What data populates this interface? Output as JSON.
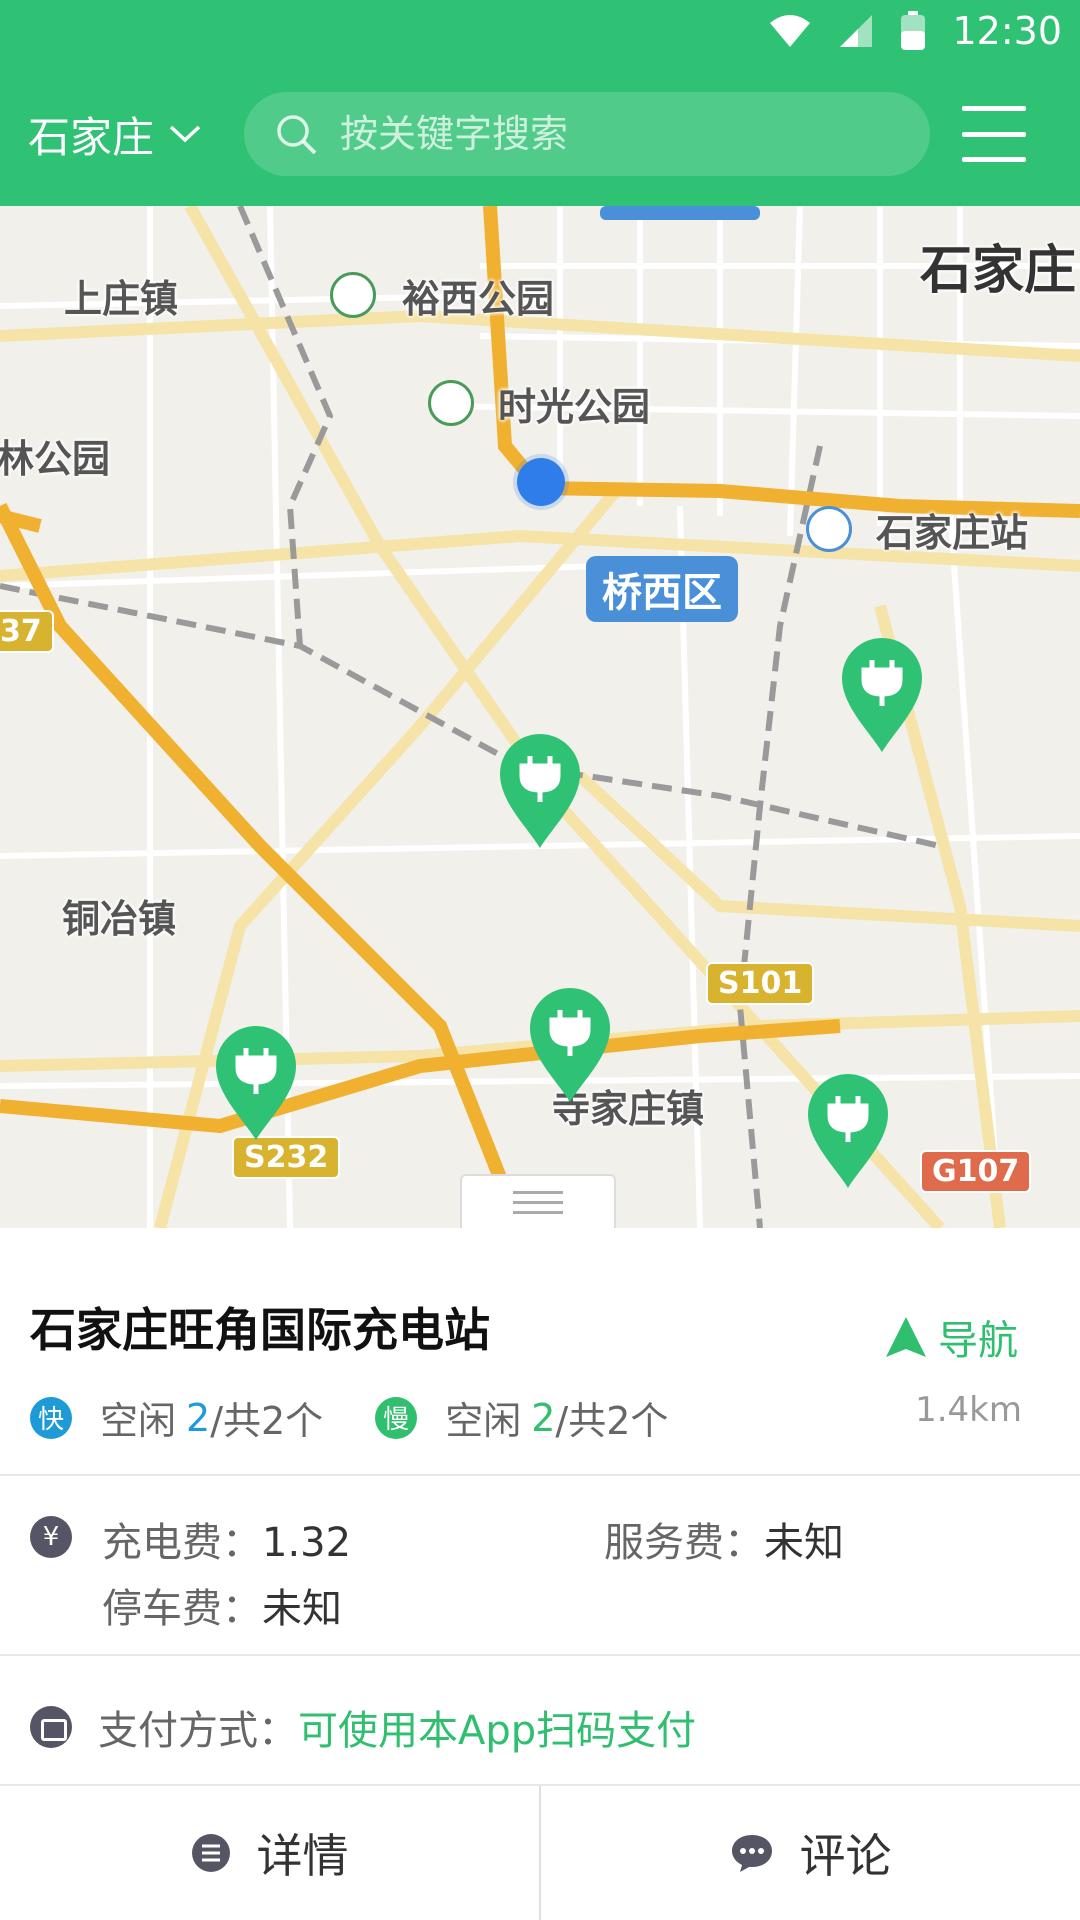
{
  "status_bar": {
    "time": "12:30",
    "icons": [
      "wifi-icon",
      "cell-signal-icon",
      "battery-icon"
    ]
  },
  "header": {
    "city": "石家庄",
    "search_placeholder": "按关键字搜索",
    "icons": [
      "chevron-down-icon",
      "search-icon",
      "menu-icon"
    ]
  },
  "map": {
    "place_labels": [
      "上庄镇",
      "裕西公园",
      "时光公园",
      "林公园",
      "石家庄站",
      "石家庄",
      "铜冶镇",
      "寺家庄镇"
    ],
    "district": "桥西区",
    "road_shields": [
      "S101",
      "S232",
      "G107",
      "37"
    ],
    "charging_pins": 5,
    "colors": {
      "marker": "#2fc174",
      "location": "#2f7de9",
      "major_road": "#f0b030"
    }
  },
  "station": {
    "name": "石家庄旺角国际充电站",
    "nav_label": "导航",
    "distance": "1.4km",
    "fast": {
      "badge": "快",
      "label": "空闲",
      "free": "2",
      "total": "/共2个"
    },
    "slow": {
      "badge": "慢",
      "label": "空闲",
      "free": "2",
      "total": "/共2个"
    },
    "fees": {
      "icon_glyph": "¥",
      "charge_label": "充电费：",
      "charge_value": "1.32",
      "service_label": "服务费：",
      "service_value": "未知",
      "parking_label": "停车费：",
      "parking_value": "未知"
    },
    "payment": {
      "label": "支付方式：",
      "value": "可使用本App扫码支付"
    }
  },
  "tabs": [
    {
      "label": "详情",
      "icon": "list-icon"
    },
    {
      "label": "评论",
      "icon": "comment-icon"
    }
  ],
  "theme": {
    "brand_green": "#2fc174",
    "fast_blue": "#1e9bd7",
    "text_gray": "#666666"
  }
}
